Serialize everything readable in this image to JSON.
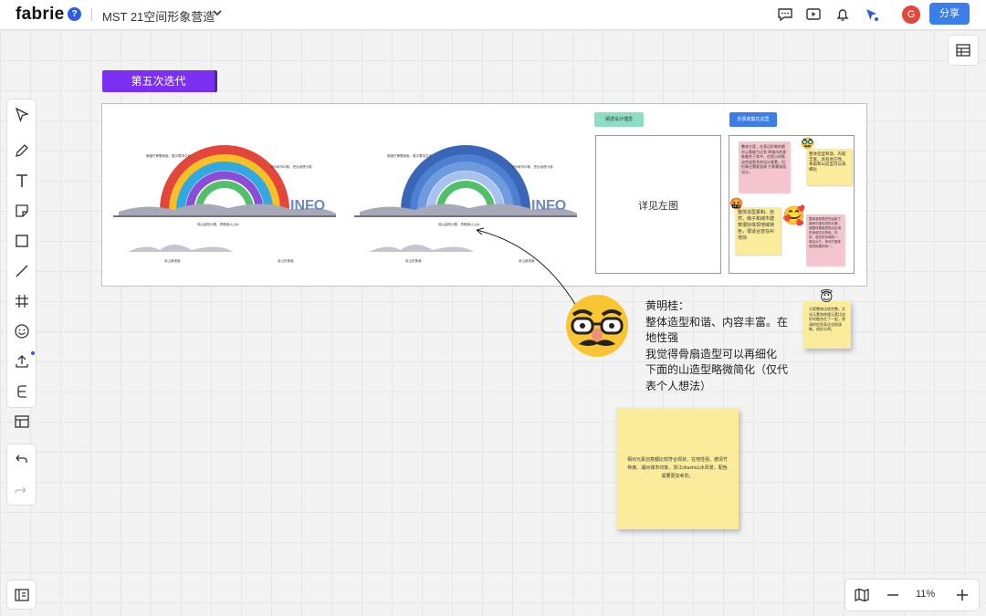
{
  "header": {
    "logo": "fabrie",
    "help": "?",
    "document_title": "MST 21空间形象营造",
    "avatar_letter": "G",
    "share_label": "分享"
  },
  "toolbar": {
    "tools": [
      "select-icon",
      "pen-icon",
      "text-icon",
      "sticky-note-icon",
      "rectangle-icon",
      "line-icon",
      "frame-icon",
      "emoji-icon",
      "upload-icon",
      "connector-icon",
      "table-icon"
    ]
  },
  "zoom": {
    "value": "11%"
  },
  "board": {
    "iteration_label": "第五次迭代",
    "green_tag": "阐述设计理念",
    "blue_tag": "反馈收集在这里",
    "left_box_text": "详见左图",
    "design_left_labels": [
      "微缩竹骨蜀扇面，展示蜀滇文化",
      "湖州城市印象，把合地理小镇",
      "瑞山曲阳元素，勇敢面以山水",
      "亲山景观面",
      "亲山形象面"
    ],
    "design_right_labels": [
      "微缩竹骨蜀扇面，展示蜀滇文化",
      "湖州城市印象，把合地理小镇",
      "瑞山曲阳元素，勇敢面以山水",
      "亲山形象面",
      "亲山景观面"
    ],
    "feedback_notes": [
      "整体方案，在表达形象的都市元素能力达到 将城市的意象融合于其中，在提示的推动完成更多的设计要素，但形象还需要强调 竹骨蜀扇面 设计。",
      "整体造型和谐、内容丰富，具有地方性。骨扇和山造型可以再细化",
      "整体造型柔和、自然，扇子和城市建筑很好体现地域特色，很适合放在AI地块",
      "整体造型很好的运用了各种中国传统的元素，使整体更能表现出区域的地域文化特色。形状、色彩的协调统一，简洁大方，有利于整体视觉效果的统一。"
    ],
    "comment_lines": [
      "黄明桂：",
      "整体造型和谐、内容丰富。在地性强",
      "我觉得骨扇造型可以再细化",
      "下面的山造型略微简化（仅代表个人想法）"
    ],
    "big_note_text": "相对元素创意都比较符合现状，在地性强，德清竹骨扇、湖州城市印象、浙江shashi山水风景，配色需要更加考究。",
    "small_note_text": "方案整体比较完整，文化元素和地理元素比较好的融合在了一起，德清的信息表达也很清晰，很好分明。"
  },
  "colors": {
    "accent": "#3b7de9",
    "iteration": "#7b2ff2",
    "sticky_yellow": "#fbec9b",
    "sticky_pink": "#f5c5cf"
  }
}
